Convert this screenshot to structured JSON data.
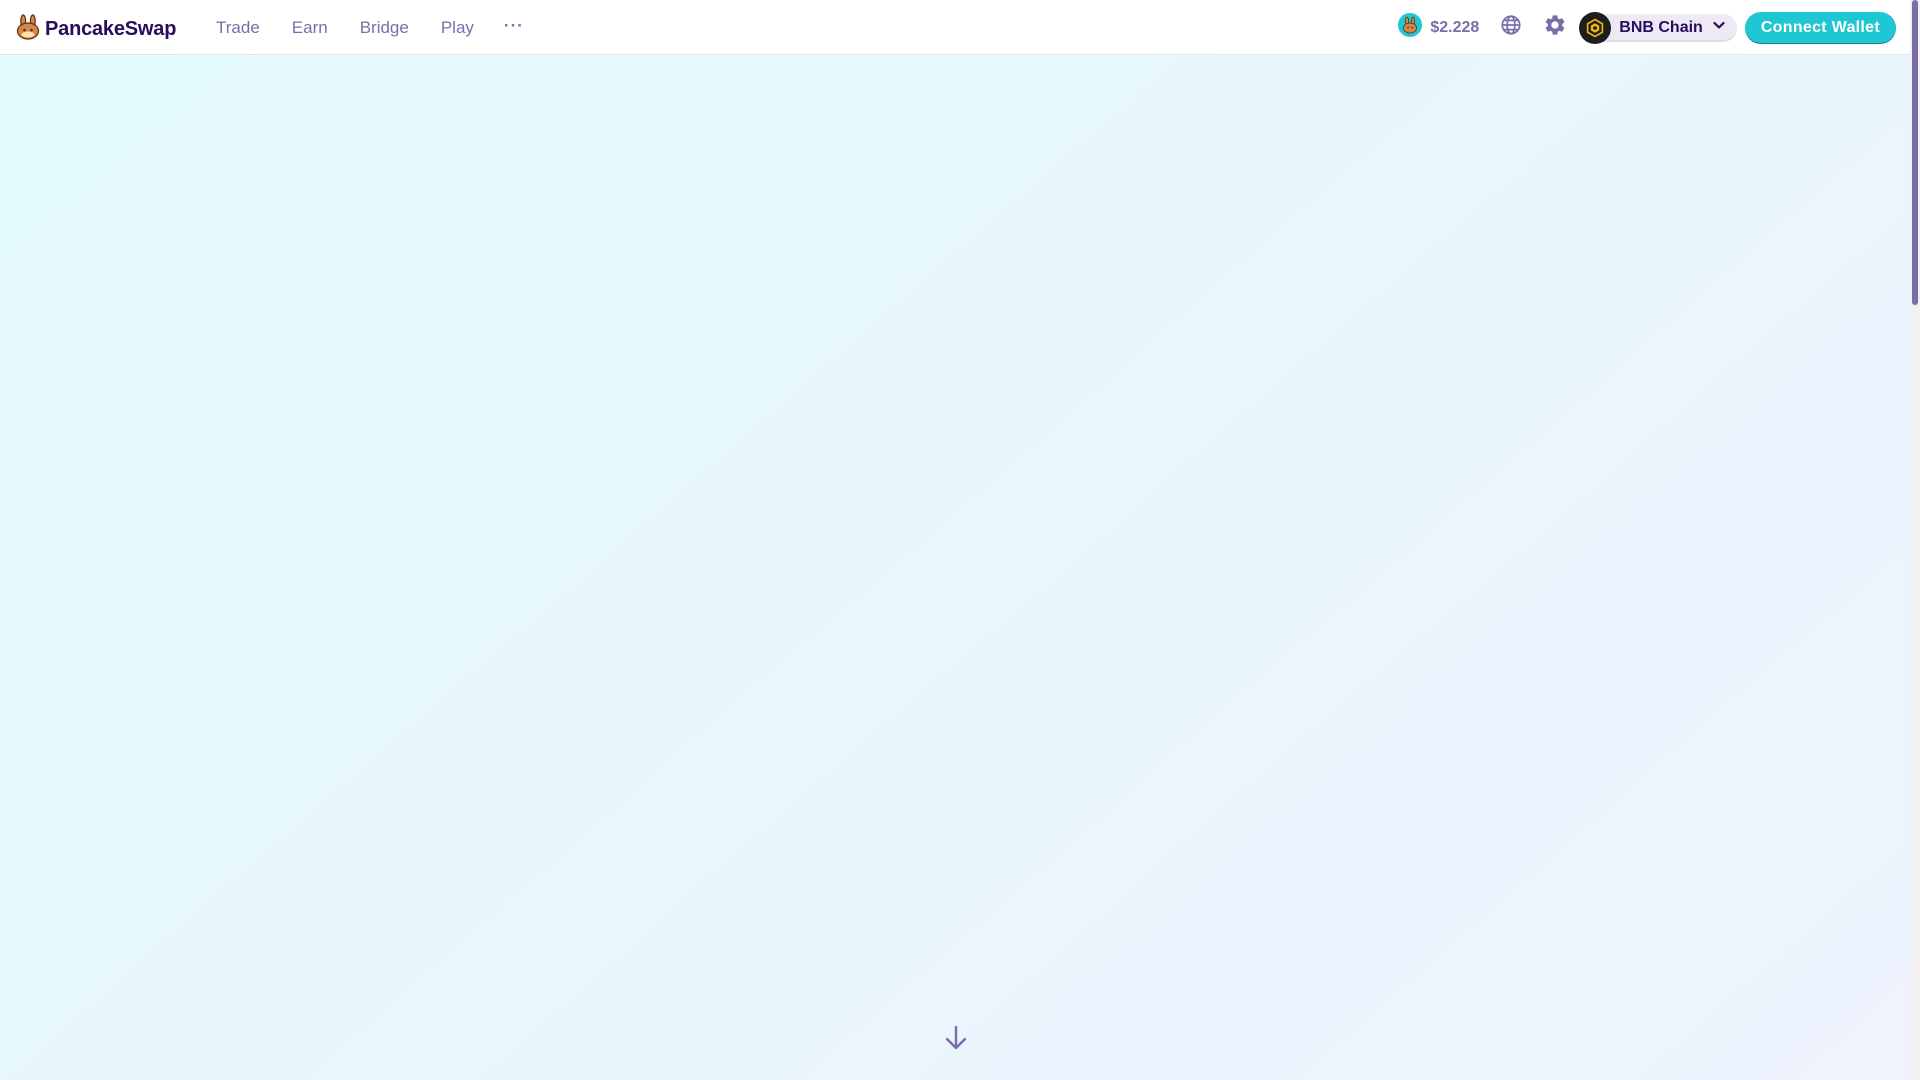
{
  "header": {
    "brand": "PancakeSwap",
    "brand_icon": "pancakeswap-bunny-icon",
    "nav": {
      "trade": "Trade",
      "earn": "Earn",
      "bridge": "Bridge",
      "play": "Play",
      "more": "···"
    },
    "cake_price": "$2.228",
    "cake_icon": "cake-token-icon",
    "language_icon": "globe-icon",
    "settings_icon": "gear-icon",
    "network": {
      "label": "BNB Chain",
      "icon": "bnb-chain-icon"
    },
    "connect_wallet": "Connect Wallet"
  },
  "scroll_hint_icon": "arrow-down-icon",
  "colors": {
    "primary": "#1fc7d4",
    "text_secondary": "#7a6eaa",
    "text_primary": "#280d5f",
    "background_start": "#e4fcff",
    "background_end": "#eef3fe"
  }
}
